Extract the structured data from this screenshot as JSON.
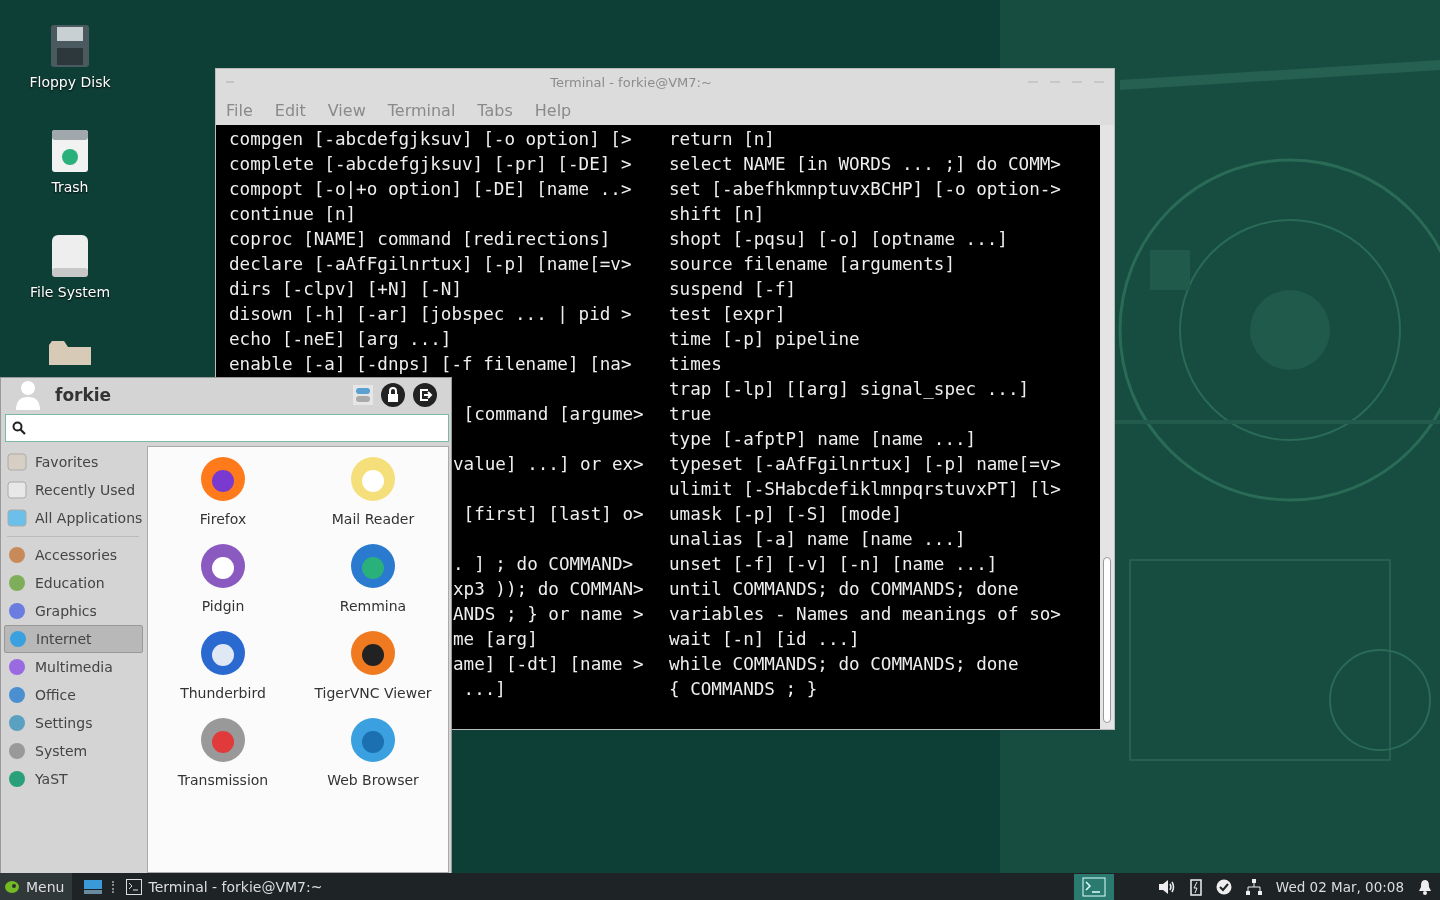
{
  "desktop_icons": [
    {
      "label": "Floppy Disk"
    },
    {
      "label": "Trash"
    },
    {
      "label": "File System"
    }
  ],
  "terminal": {
    "title": "Terminal - forkie@VM7:~",
    "active": false,
    "menu_bar": [
      "File",
      "Edit",
      "View",
      "Terminal",
      "Tabs",
      "Help"
    ],
    "left_lines": [
      "compgen [-abcdefgjksuv] [-o option] [>",
      "complete [-abcdefgjksuv] [-pr] [-DE] >",
      "compopt [-o|+o option] [-DE] [name ..>",
      "continue [n]",
      "coproc [NAME] command [redirections]",
      "declare [-aAfFgilnrtux] [-p] [name[=v>",
      "dirs [-clpv] [+N] [-N]",
      "disown [-h] [-ar] [jobspec ... | pid >",
      "echo [-neE] [arg ...]",
      "enable [-a] [-dnps] [-f filename] [na>"
    ],
    "left_fragment_groups": [
      [
        " [command [argume>"
      ],
      [
        "value] ...] or ex>"
      ],
      [
        " [first] [last] o>"
      ],
      [
        ". ] ; do COMMAND>",
        "xp3 )); do COMMAN>",
        "ANDS ; } or name >",
        "me [arg]",
        "ame] [-dt] [name >",
        " ...]"
      ]
    ],
    "right_lines": [
      "return [n]",
      "select NAME [in WORDS ... ;] do COMM>",
      "set [-abefhkmnptuvxBCHP] [-o option->",
      "shift [n]",
      "shopt [-pqsu] [-o] [optname ...]",
      "source filename [arguments]",
      "suspend [-f]",
      "test [expr]",
      "time [-p] pipeline",
      "times",
      "trap [-lp] [[arg] signal_spec ...]",
      "true",
      "type [-afptP] name [name ...]",
      "typeset [-aAfFgilnrtux] [-p] name[=v>",
      "ulimit [-SHabcdefiklmnpqrstuvxPT] [l>",
      "umask [-p] [-S] [mode]",
      "unalias [-a] name [name ...]",
      "unset [-f] [-v] [-n] [name ...]",
      "until COMMANDS; do COMMANDS; done",
      "variables - Names and meanings of so>",
      "wait [-n] [id ...]",
      "while COMMANDS; do COMMANDS; done",
      "{ COMMANDS ; }"
    ]
  },
  "app_menu": {
    "user": "forkie",
    "places": [
      {
        "label": "Favorites",
        "selected": false
      },
      {
        "label": "Recently Used",
        "selected": false
      },
      {
        "label": "All Applications",
        "selected": false
      }
    ],
    "categories": [
      {
        "label": "Accessories",
        "selected": false
      },
      {
        "label": "Education",
        "selected": false
      },
      {
        "label": "Graphics",
        "selected": false
      },
      {
        "label": "Internet",
        "selected": true
      },
      {
        "label": "Multimedia",
        "selected": false
      },
      {
        "label": "Office",
        "selected": false
      },
      {
        "label": "Settings",
        "selected": false
      },
      {
        "label": "System",
        "selected": false
      },
      {
        "label": "YaST",
        "selected": false
      }
    ],
    "apps": [
      {
        "label": "Firefox"
      },
      {
        "label": "Mail Reader"
      },
      {
        "label": "Pidgin"
      },
      {
        "label": "Remmina"
      },
      {
        "label": "Thunderbird"
      },
      {
        "label": "TigerVNC Viewer"
      },
      {
        "label": "Transmission"
      },
      {
        "label": "Web Browser"
      }
    ]
  },
  "taskbar": {
    "menu": "Menu",
    "tasks": [
      {
        "label": "Terminal - forkie@VM7:~"
      }
    ],
    "clock": "Wed 02 Mar, 00:08"
  }
}
